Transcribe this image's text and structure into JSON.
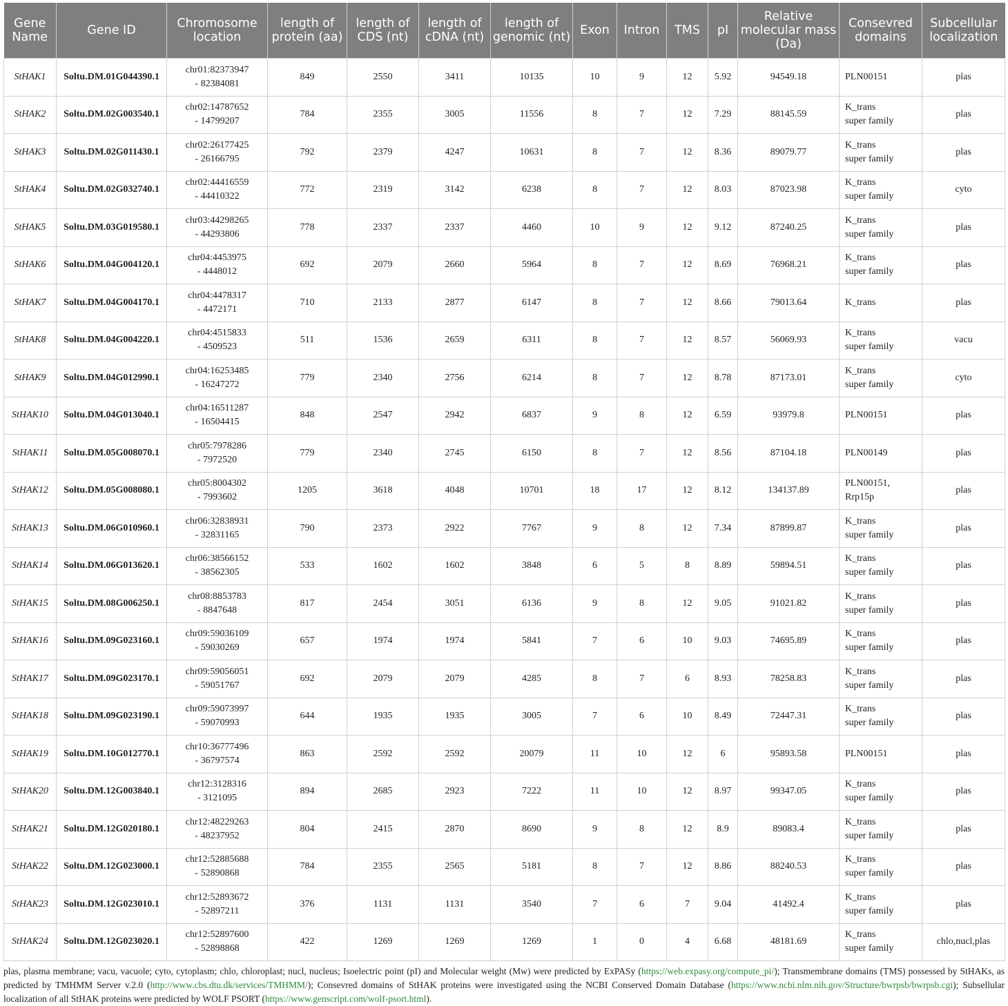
{
  "headers": [
    "Gene Name",
    "Gene ID",
    "Chromosome location",
    "length of protein (aa)",
    "length of CDS (nt)",
    "length of cDNA (nt)",
    "length of genomic (nt)",
    "Exon",
    "Intron",
    "TMS",
    "pI",
    "Relative molecular mass (Da)",
    "Consevred domains",
    "Subcellular localization"
  ],
  "rows": [
    {
      "name": "StHAK1",
      "id": "Soltu.DM.01G044390.1",
      "loc1": "chr01:82373947",
      "loc2": "- 82384081",
      "protein": "849",
      "cds": "2550",
      "cdna": "3411",
      "genomic": "10135",
      "exon": "10",
      "intron": "9",
      "tms": "12",
      "pi": "5.92",
      "mass": "94549.18",
      "dom1": "PLN00151",
      "dom2": "",
      "sub": "plas"
    },
    {
      "name": "StHAK2",
      "id": "Soltu.DM.02G003540.1",
      "loc1": "chr02:14787652",
      "loc2": "- 14799207",
      "protein": "784",
      "cds": "2355",
      "cdna": "3005",
      "genomic": "11556",
      "exon": "8",
      "intron": "7",
      "tms": "12",
      "pi": "7.29",
      "mass": "88145.59",
      "dom1": "K_trans",
      "dom2": "super family",
      "sub": "plas"
    },
    {
      "name": "StHAK3",
      "id": "Soltu.DM.02G011430.1",
      "loc1": "chr02:26177425",
      "loc2": "- 26166795",
      "protein": "792",
      "cds": "2379",
      "cdna": "4247",
      "genomic": "10631",
      "exon": "8",
      "intron": "7",
      "tms": "12",
      "pi": "8.36",
      "mass": "89079.77",
      "dom1": "K_trans",
      "dom2": "super family",
      "sub": "plas"
    },
    {
      "name": "StHAK4",
      "id": "Soltu.DM.02G032740.1",
      "loc1": "chr02:44416559",
      "loc2": "- 44410322",
      "protein": "772",
      "cds": "2319",
      "cdna": "3142",
      "genomic": "6238",
      "exon": "8",
      "intron": "7",
      "tms": "12",
      "pi": "8.03",
      "mass": "87023.98",
      "dom1": "K_trans",
      "dom2": "super family",
      "sub": "cyto"
    },
    {
      "name": "StHAK5",
      "id": "Soltu.DM.03G019580.1",
      "loc1": "chr03:44298265",
      "loc2": "- 44293806",
      "protein": "778",
      "cds": "2337",
      "cdna": "2337",
      "genomic": "4460",
      "exon": "10",
      "intron": "9",
      "tms": "12",
      "pi": "9.12",
      "mass": "87240.25",
      "dom1": "K_trans",
      "dom2": "super family",
      "sub": "plas"
    },
    {
      "name": "StHAK6",
      "id": "Soltu.DM.04G004120.1",
      "loc1": "chr04:4453975",
      "loc2": "- 4448012",
      "protein": "692",
      "cds": "2079",
      "cdna": "2660",
      "genomic": "5964",
      "exon": "8",
      "intron": "7",
      "tms": "12",
      "pi": "8.69",
      "mass": "76968.21",
      "dom1": "K_trans",
      "dom2": "super family",
      "sub": "plas"
    },
    {
      "name": "StHAK7",
      "id": "Soltu.DM.04G004170.1",
      "loc1": "chr04:4478317",
      "loc2": "- 4472171",
      "protein": "710",
      "cds": "2133",
      "cdna": "2877",
      "genomic": "6147",
      "exon": "8",
      "intron": "7",
      "tms": "12",
      "pi": "8.66",
      "mass": "79013.64",
      "dom1": "K_trans",
      "dom2": "",
      "sub": "plas"
    },
    {
      "name": "StHAK8",
      "id": "Soltu.DM.04G004220.1",
      "loc1": "chr04:4515833",
      "loc2": "- 4509523",
      "protein": "511",
      "cds": "1536",
      "cdna": "2659",
      "genomic": "6311",
      "exon": "8",
      "intron": "7",
      "tms": "12",
      "pi": "8.57",
      "mass": "56069.93",
      "dom1": "K_trans",
      "dom2": "super family",
      "sub": "vacu"
    },
    {
      "name": "StHAK9",
      "id": "Soltu.DM.04G012990.1",
      "loc1": "chr04:16253485",
      "loc2": "- 16247272",
      "protein": "779",
      "cds": "2340",
      "cdna": "2756",
      "genomic": "6214",
      "exon": "8",
      "intron": "7",
      "tms": "12",
      "pi": "8.78",
      "mass": "87173.01",
      "dom1": "K_trans",
      "dom2": "super family",
      "sub": "cyto"
    },
    {
      "name": "StHAK10",
      "id": "Soltu.DM.04G013040.1",
      "loc1": "chr04:16511287",
      "loc2": "- 16504415",
      "protein": "848",
      "cds": "2547",
      "cdna": "2942",
      "genomic": "6837",
      "exon": "9",
      "intron": "8",
      "tms": "12",
      "pi": "6.59",
      "mass": "93979.8",
      "dom1": "PLN00151",
      "dom2": "",
      "sub": "plas"
    },
    {
      "name": "StHAK11",
      "id": "Soltu.DM.05G008070.1",
      "loc1": "chr05:7978286",
      "loc2": "- 7972520",
      "protein": "779",
      "cds": "2340",
      "cdna": "2745",
      "genomic": "6150",
      "exon": "8",
      "intron": "7",
      "tms": "12",
      "pi": "8.56",
      "mass": "87104.18",
      "dom1": "PLN00149",
      "dom2": "",
      "sub": "plas"
    },
    {
      "name": "StHAK12",
      "id": "Soltu.DM.05G008080.1",
      "loc1": "chr05:8004302",
      "loc2": "- 7993602",
      "protein": "1205",
      "cds": "3618",
      "cdna": "4048",
      "genomic": "10701",
      "exon": "18",
      "intron": "17",
      "tms": "12",
      "pi": "8.12",
      "mass": "134137.89",
      "dom1": "PLN00151,",
      "dom2": "Rrp15p",
      "sub": "plas"
    },
    {
      "name": "StHAK13",
      "id": "Soltu.DM.06G010960.1",
      "loc1": "chr06:32838931",
      "loc2": "- 32831165",
      "protein": "790",
      "cds": "2373",
      "cdna": "2922",
      "genomic": "7767",
      "exon": "9",
      "intron": "8",
      "tms": "12",
      "pi": "7.34",
      "mass": "87899.87",
      "dom1": "K_trans",
      "dom2": "super family",
      "sub": "plas"
    },
    {
      "name": "StHAK14",
      "id": "Soltu.DM.06G013620.1",
      "loc1": "chr06:38566152",
      "loc2": "- 38562305",
      "protein": "533",
      "cds": "1602",
      "cdna": "1602",
      "genomic": "3848",
      "exon": "6",
      "intron": "5",
      "tms": "8",
      "pi": "8.89",
      "mass": "59894.51",
      "dom1": "K_trans",
      "dom2": "super family",
      "sub": "plas"
    },
    {
      "name": "StHAK15",
      "id": "Soltu.DM.08G006250.1",
      "loc1": "chr08:8853783",
      "loc2": "- 8847648",
      "protein": "817",
      "cds": "2454",
      "cdna": "3051",
      "genomic": "6136",
      "exon": "9",
      "intron": "8",
      "tms": "12",
      "pi": "9.05",
      "mass": "91021.82",
      "dom1": "K_trans",
      "dom2": "super family",
      "sub": "plas"
    },
    {
      "name": "StHAK16",
      "id": "Soltu.DM.09G023160.1",
      "loc1": "chr09:59036109",
      "loc2": "- 59030269",
      "protein": "657",
      "cds": "1974",
      "cdna": "1974",
      "genomic": "5841",
      "exon": "7",
      "intron": "6",
      "tms": "10",
      "pi": "9.03",
      "mass": "74695.89",
      "dom1": "K_trans",
      "dom2": "super family",
      "sub": "plas"
    },
    {
      "name": "StHAK17",
      "id": "Soltu.DM.09G023170.1",
      "loc1": "chr09:59056051",
      "loc2": "- 59051767",
      "protein": "692",
      "cds": "2079",
      "cdna": "2079",
      "genomic": "4285",
      "exon": "8",
      "intron": "7",
      "tms": "6",
      "pi": "8.93",
      "mass": "78258.83",
      "dom1": "K_trans",
      "dom2": "super family",
      "sub": "plas"
    },
    {
      "name": "StHAK18",
      "id": "Soltu.DM.09G023190.1",
      "loc1": "chr09:59073997",
      "loc2": "- 59070993",
      "protein": "644",
      "cds": "1935",
      "cdna": "1935",
      "genomic": "3005",
      "exon": "7",
      "intron": "6",
      "tms": "10",
      "pi": "8.49",
      "mass": "72447.31",
      "dom1": "K_trans",
      "dom2": "super family",
      "sub": "plas"
    },
    {
      "name": "StHAK19",
      "id": "Soltu.DM.10G012770.1",
      "loc1": "chr10:36777496",
      "loc2": "- 36797574",
      "protein": "863",
      "cds": "2592",
      "cdna": "2592",
      "genomic": "20079",
      "exon": "11",
      "intron": "10",
      "tms": "12",
      "pi": "6",
      "mass": "95893.58",
      "dom1": "PLN00151",
      "dom2": "",
      "sub": "plas"
    },
    {
      "name": "StHAK20",
      "id": "Soltu.DM.12G003840.1",
      "loc1": "chr12:3128316",
      "loc2": "- 3121095",
      "protein": "894",
      "cds": "2685",
      "cdna": "2923",
      "genomic": "7222",
      "exon": "11",
      "intron": "10",
      "tms": "12",
      "pi": "8.97",
      "mass": "99347.05",
      "dom1": "K_trans",
      "dom2": "super family",
      "sub": "plas"
    },
    {
      "name": "StHAK21",
      "id": "Soltu.DM.12G020180.1",
      "loc1": "chr12:48229263",
      "loc2": "- 48237952",
      "protein": "804",
      "cds": "2415",
      "cdna": "2870",
      "genomic": "8690",
      "exon": "9",
      "intron": "8",
      "tms": "12",
      "pi": "8.9",
      "mass": "89083.4",
      "dom1": "K_trans",
      "dom2": "super family",
      "sub": "plas"
    },
    {
      "name": "StHAK22",
      "id": "Soltu.DM.12G023000.1",
      "loc1": "chr12:52885688",
      "loc2": "- 52890868",
      "protein": "784",
      "cds": "2355",
      "cdna": "2565",
      "genomic": "5181",
      "exon": "8",
      "intron": "7",
      "tms": "12",
      "pi": "8.86",
      "mass": "88240.53",
      "dom1": "K_trans",
      "dom2": "super family",
      "sub": "plas"
    },
    {
      "name": "StHAK23",
      "id": "Soltu.DM.12G023010.1",
      "loc1": "chr12:52893672",
      "loc2": "- 52897211",
      "protein": "376",
      "cds": "1131",
      "cdna": "1131",
      "genomic": "3540",
      "exon": "7",
      "intron": "6",
      "tms": "7",
      "pi": "9.04",
      "mass": "41492.4",
      "dom1": "K_trans",
      "dom2": "super family",
      "sub": "plas"
    },
    {
      "name": "StHAK24",
      "id": "Soltu.DM.12G023020.1",
      "loc1": "chr12:52897600",
      "loc2": "- 52898868",
      "protein": "422",
      "cds": "1269",
      "cdna": "1269",
      "genomic": "1269",
      "exon": "1",
      "intron": "0",
      "tms": "4",
      "pi": "6.68",
      "mass": "48181.69",
      "dom1": "K_trans",
      "dom2": "super family",
      "sub": "chlo,nucl,plas"
    }
  ],
  "footnote": {
    "t1": "plas, plasma membrane; vacu, vacuole; cyto, cytoplasm; chlo, chloroplast; nucl, nucleus; Isoelectric point (pI) and Molecular weight (Mw) were predicted by ExPASy (",
    "l1": "https://web.expasy.org/compute_pi/",
    "t2": "); Transmembrane domains (TMS) possessed by StHAKs, as predicted by TMHMM Server v.2.0 (",
    "l2": "http://www.cbs.dtu.dk/services/TMHMM/",
    "t3": "); Consevred domains of StHAK proteins were investigated using the NCBI Conserved Domain Database (",
    "l3": "https://www.ncbi.nlm.nih.gov/Structure/bwrpsb/bwrpsb.cgi",
    "t4": "); Subsellular localization of all StHAK proteins were predicted by WOLF PSORT (",
    "l4": "https://www.genscript.com/wolf-psort.html",
    "t5": ").",
    "link_color": "#2e8b3a"
  },
  "colors": {
    "header_bg": "#7f7f7f",
    "header_text": "#ffffff",
    "border": "#cfcfcf"
  }
}
